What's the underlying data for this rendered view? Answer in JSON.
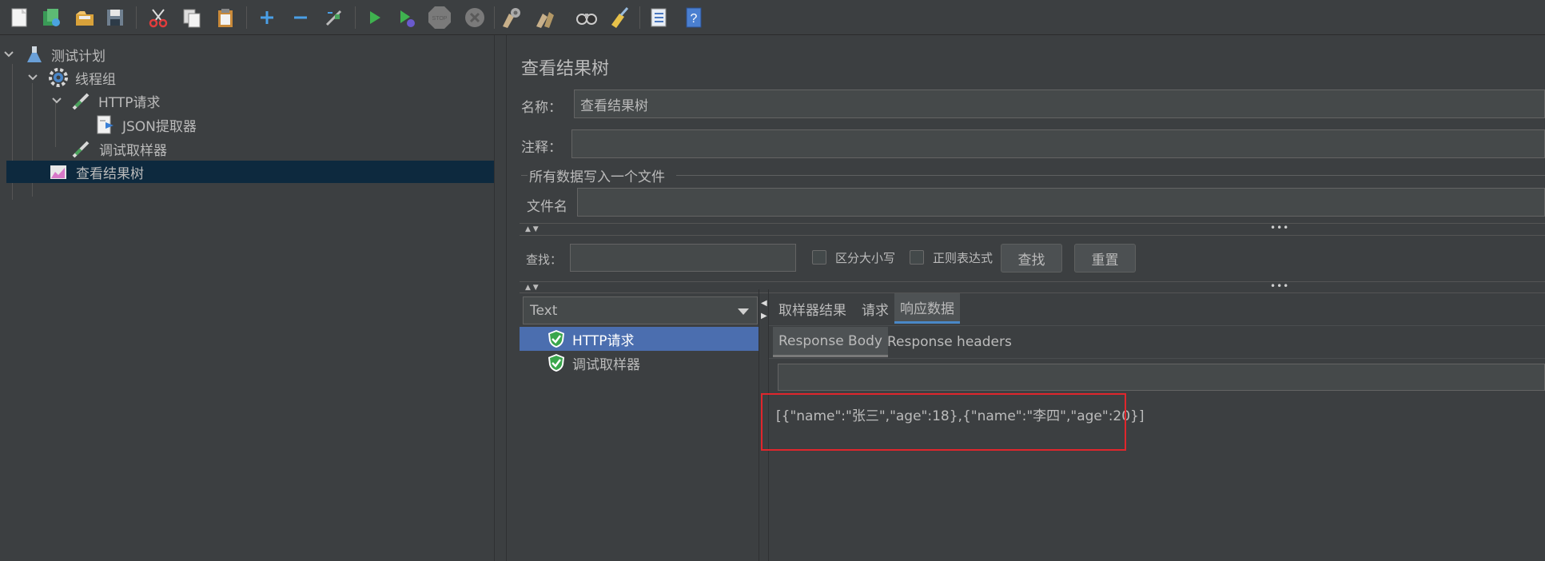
{
  "toolbar": {
    "icons": [
      "new-icon",
      "templates-icon",
      "open-icon",
      "save-icon",
      "cut-icon",
      "copy-icon",
      "paste-icon",
      "expand-icon",
      "collapse-icon",
      "toggle-icon",
      "start-icon",
      "start-no-pause-icon",
      "stop-icon",
      "shutdown-icon",
      "clear-icon",
      "clear-all-icon",
      "search-icon",
      "reset-search-icon",
      "function-helper-icon",
      "help-icon"
    ]
  },
  "tree": {
    "items": [
      {
        "label": "测试计划",
        "icon": "flask-icon"
      },
      {
        "label": "线程组",
        "icon": "gear-icon"
      },
      {
        "label": "HTTP请求",
        "icon": "sampler-pipette-icon"
      },
      {
        "label": "JSON提取器",
        "icon": "extractor-doc-icon"
      },
      {
        "label": "调试取样器",
        "icon": "sampler-pipette-icon"
      },
      {
        "label": "查看结果树",
        "icon": "graph-icon"
      }
    ]
  },
  "panel": {
    "title": "查看结果树",
    "name_label": "名称：",
    "name_value": "查看结果树",
    "comment_label": "注释：",
    "comment_value": "",
    "file_group_label": "所有数据写入一个文件",
    "filename_label": "文件名",
    "filename_value": ""
  },
  "search": {
    "label": "查找：",
    "value": "",
    "case_label": "区分大小写",
    "regex_label": "正则表达式",
    "find_button": "查找",
    "reset_button": "重置"
  },
  "results": {
    "renderer": "Text",
    "items": [
      {
        "label": "HTTP请求",
        "status": "success"
      },
      {
        "label": "调试取样器",
        "status": "success"
      }
    ]
  },
  "tabs": {
    "top": [
      "取样器结果",
      "请求",
      "响应数据"
    ],
    "active_top": "响应数据",
    "sub": [
      "Response Body",
      "Response headers"
    ],
    "active_sub": "Response Body"
  },
  "response": {
    "body": "[{\"name\":\"张三\",\"age\":18},{\"name\":\"李四\",\"age\":20}]"
  },
  "colors": {
    "background": "#3c3f41",
    "selection": "#4b6eaf",
    "highlight_box": "#e0262c"
  }
}
